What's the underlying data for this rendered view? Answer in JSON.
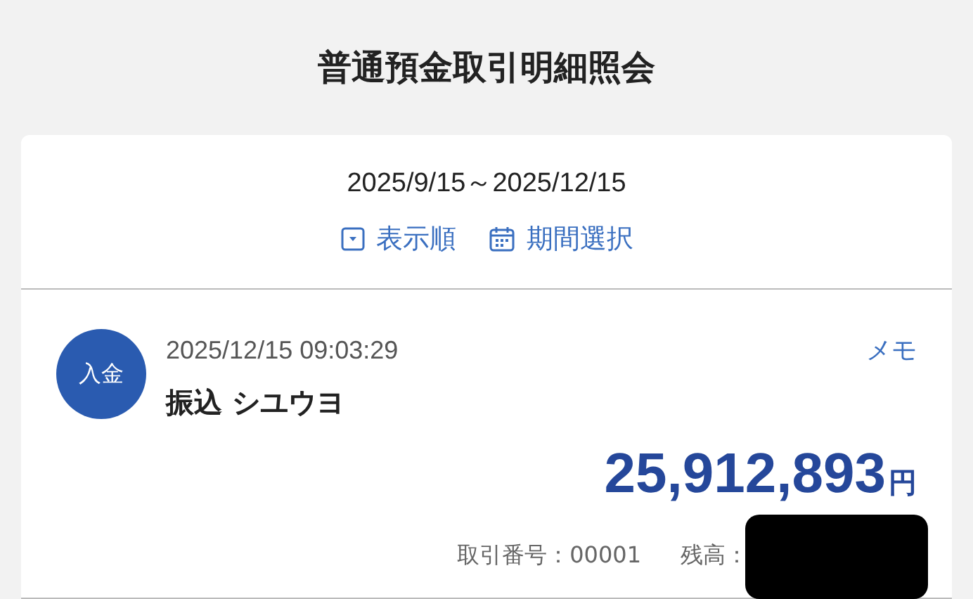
{
  "title": "普通預金取引明細照会",
  "period": "2025/9/15～2025/12/15",
  "actions": [
    {
      "kind": "sort",
      "label": "表示順"
    },
    {
      "kind": "calendar",
      "label": "期間選択"
    }
  ],
  "transactions": [
    {
      "badge": "入金",
      "datetime": "2025/12/15 09:03:29",
      "memo": "メモ",
      "description": "振込 シユウヨ",
      "amount": "25,912,893",
      "currency": "円",
      "number_label": "取引番号：00001",
      "balance_label": "残高：",
      "balance_redacted": true
    }
  ]
}
